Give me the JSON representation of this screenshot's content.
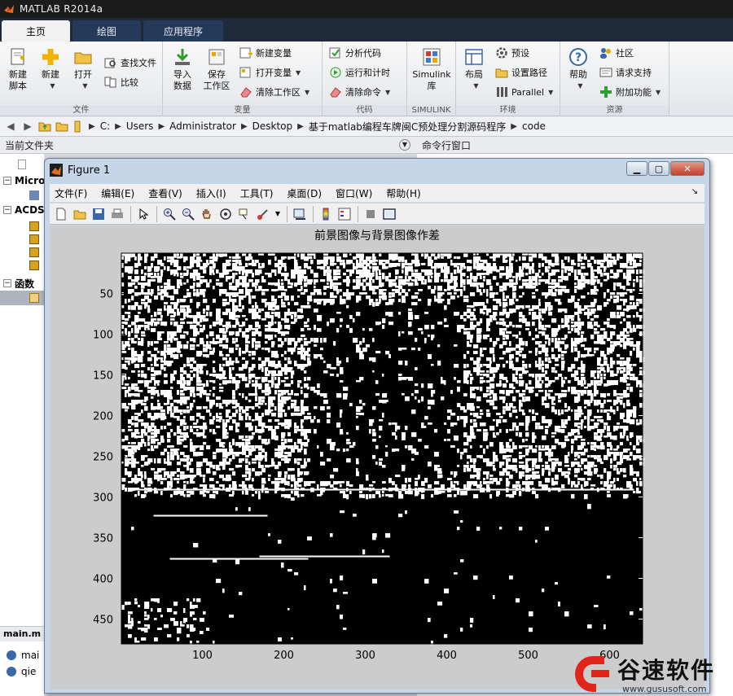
{
  "app": {
    "title": "MATLAB R2014a"
  },
  "tabs": [
    "主页",
    "绘图",
    "应用程序"
  ],
  "ribbon": {
    "file": {
      "label": "文件",
      "new_script": [
        "新建",
        "脚本"
      ],
      "new": "新建",
      "open": "打开",
      "find_files": "查找文件",
      "compare": "比较"
    },
    "variable": {
      "label": "变量",
      "import": [
        "导入",
        "数据"
      ],
      "save": [
        "保存",
        "工作区"
      ],
      "new_var": "新建变量",
      "open_var": "打开变量",
      "clear_ws": "清除工作区"
    },
    "code": {
      "label": "代码",
      "analyze": "分析代码",
      "run_time": "运行和计时",
      "clear_cmd": "清除命令"
    },
    "simulink": {
      "label": "SIMULINK",
      "btn": [
        "Simulink",
        "库"
      ]
    },
    "env": {
      "label": "环境",
      "layout": "布局",
      "prefs": "预设",
      "set_path": "设置路径",
      "parallel": "Parallel"
    },
    "resources": {
      "label": "资源",
      "help": "帮助",
      "community": "社区",
      "support": "请求支持",
      "addons": "附加功能"
    }
  },
  "address": {
    "path": [
      "C:",
      "Users",
      "Administrator",
      "Desktop",
      "基于matlab编程车牌闽C预处理分割源码程序",
      "code"
    ]
  },
  "panels": {
    "current_folder": "当前文件夹",
    "command_window": "命令行窗口"
  },
  "tree": {
    "items": [
      "Micro",
      "ACDS",
      "函数"
    ]
  },
  "details": {
    "header": "main.m (",
    "files": [
      "mai",
      "qie"
    ]
  },
  "figure": {
    "title": "Figure 1",
    "menu": [
      "文件(F)",
      "编辑(E)",
      "查看(V)",
      "插入(I)",
      "工具(T)",
      "桌面(D)",
      "窗口(W)",
      "帮助(H)"
    ]
  },
  "chart_data": {
    "type": "heatmap",
    "title": "前景图像与背景图像作差",
    "xlabel": "",
    "ylabel": "",
    "xlim": [
      0.5,
      640.5
    ],
    "ylim": [
      0.5,
      480.5
    ],
    "xticks": [
      100,
      200,
      300,
      400,
      500,
      600
    ],
    "yticks": [
      50,
      100,
      150,
      200,
      250,
      300,
      350,
      400,
      450
    ],
    "colormap": "binary",
    "y_direction": "reverse",
    "values_description_note": ""
  },
  "watermark": {
    "brand": "谷速软件",
    "url": "www.gususoft.com"
  },
  "colors": {
    "ribbon_dark": "#1f2a3a",
    "tab_blue": "#253a59",
    "figure_frame": "#c6d6e9",
    "watermark_red": "#e0251b"
  }
}
